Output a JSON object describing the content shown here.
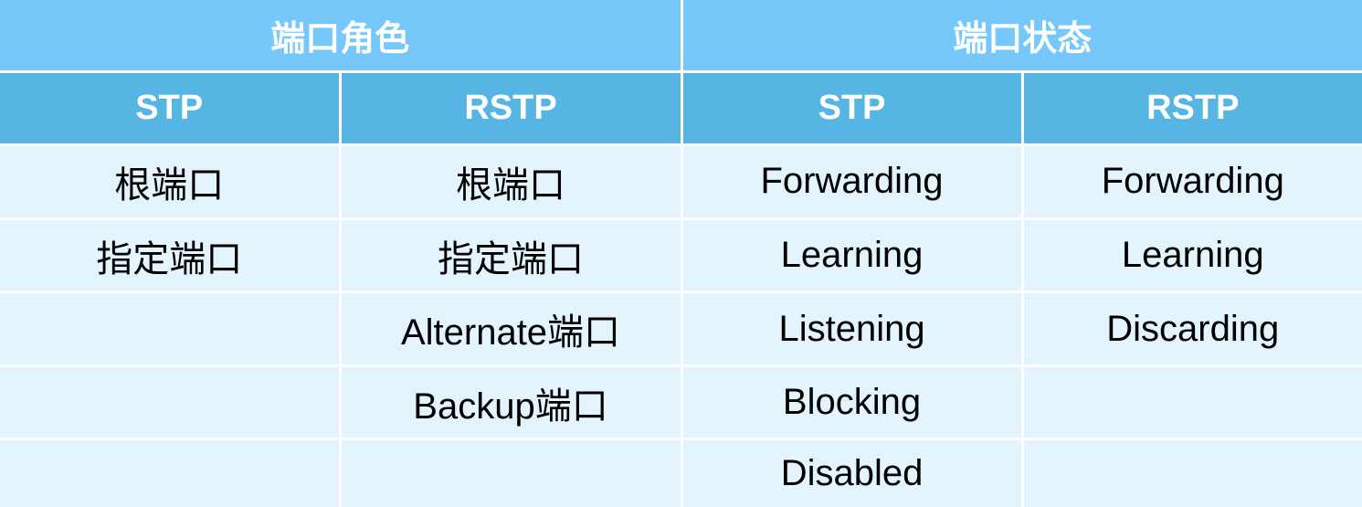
{
  "table": {
    "groups": [
      {
        "label": "端口角色"
      },
      {
        "label": "端口状态"
      }
    ],
    "subheaders": [
      "STP",
      "RSTP",
      "STP",
      "RSTP"
    ],
    "rows": [
      [
        "根端口",
        "根端口",
        "Forwarding",
        "Forwarding"
      ],
      [
        "指定端口",
        "指定端口",
        "Learning",
        "Learning"
      ],
      [
        "",
        "Alternate端口",
        "Listening",
        "Discarding"
      ],
      [
        "",
        "Backup端口",
        "Blocking",
        ""
      ],
      [
        "",
        "",
        "Disabled",
        ""
      ]
    ]
  }
}
